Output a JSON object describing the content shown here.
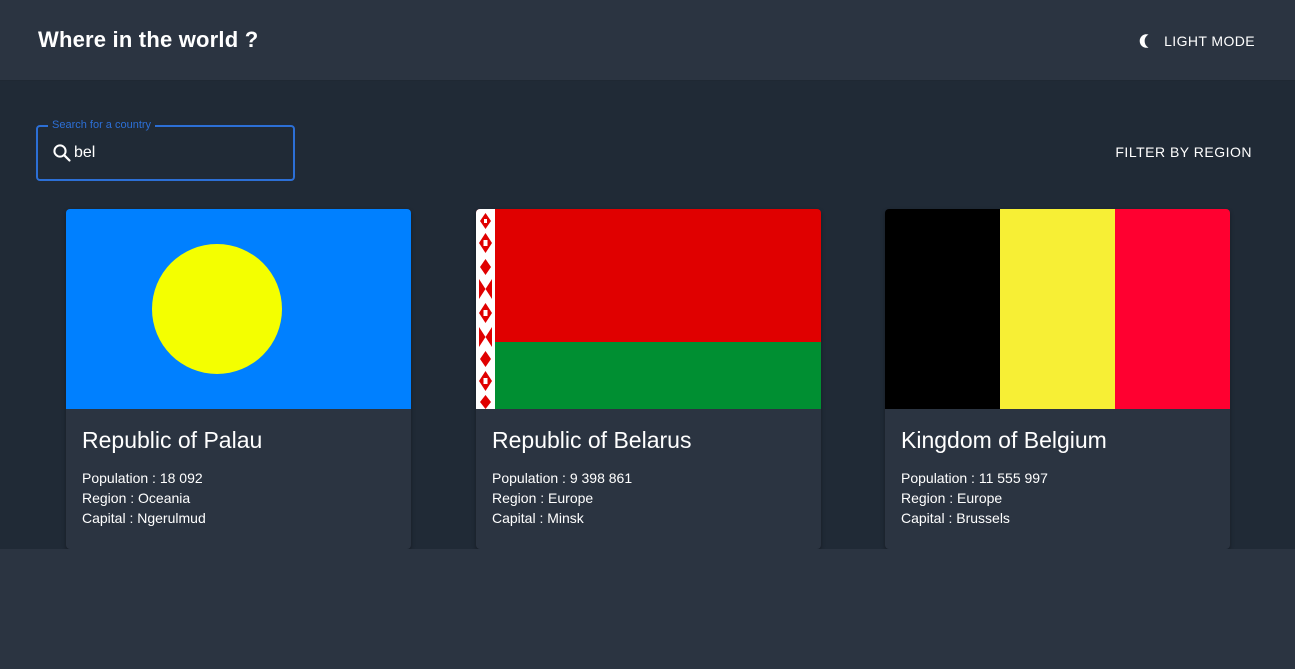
{
  "header": {
    "title": "Where in the world ?",
    "theme_toggle_label": "LIGHT MODE"
  },
  "search": {
    "legend": "Search for a country",
    "value": "bel"
  },
  "filter": {
    "label": "FILTER BY REGION"
  },
  "labels": {
    "population": "Population :",
    "region": "Region :",
    "capital": "Capital :"
  },
  "countries": [
    {
      "name": "Republic of Palau",
      "population": "18 092",
      "region": "Oceania",
      "capital": "Ngerulmud",
      "flag": "palau-flag"
    },
    {
      "name": "Republic of Belarus",
      "population": "9 398 861",
      "region": "Europe",
      "capital": "Minsk",
      "flag": "belarus-flag"
    },
    {
      "name": "Kingdom of Belgium",
      "population": "11 555 997",
      "region": "Europe",
      "capital": "Brussels",
      "flag": "belgium-flag"
    }
  ],
  "colors": {
    "background": "#202a36",
    "surface": "#2b3441",
    "accent": "#2c6fd6",
    "text": "#ffffff"
  }
}
